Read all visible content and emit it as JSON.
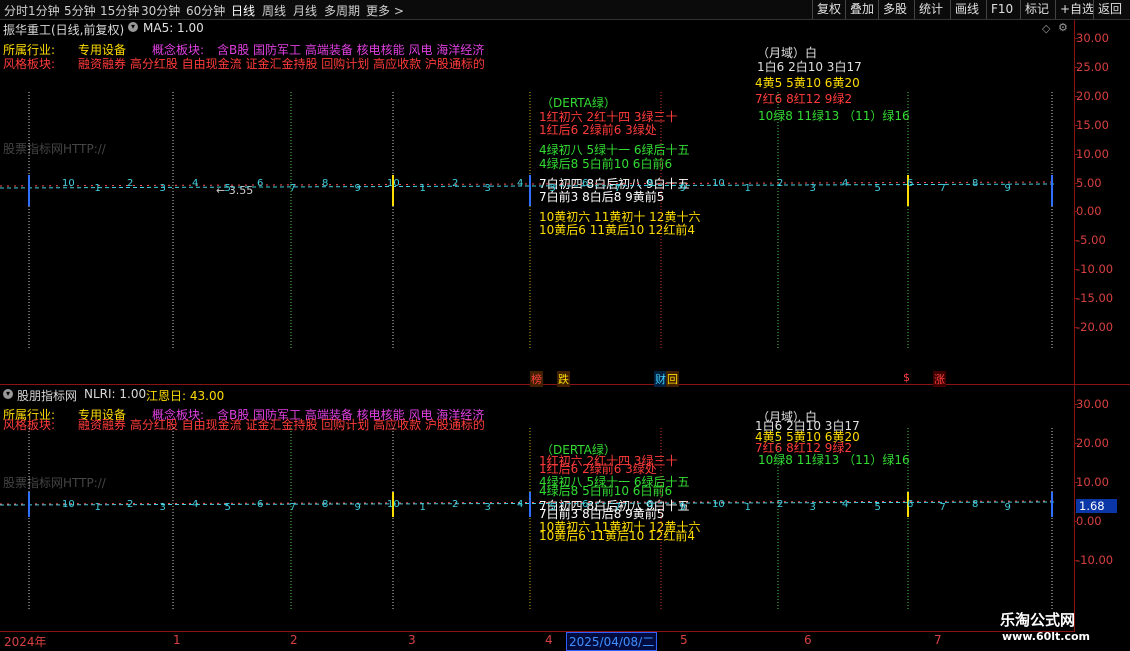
{
  "toolbar": {
    "periods": [
      "分时",
      "1分钟",
      "5分钟",
      "15分钟",
      "30分钟",
      "60分钟",
      "日线",
      "周线",
      "月线",
      "多周期",
      "更多"
    ],
    "more_arrow": ">",
    "right_buttons": [
      "复权",
      "叠加",
      "多股",
      "统计",
      "画线",
      "F10",
      "标记",
      "+自选",
      "返回"
    ]
  },
  "top_pane": {
    "stock_title": "振华重工(日线,前复权)",
    "indicator": "MA5: 1.00",
    "industry_label": "所属行业:",
    "industry_value": "专用设备",
    "concept_label": "概念板块:",
    "concept_value": "含B股 国防军工 高端装备 核电核能 风电 海洋经济",
    "style_label": "风格板块:",
    "style_value": "融资融券 高分红股 自由现金流 证金汇金持股 回购计划 高应收款 沪股通标的",
    "watermark": "股票指标网HTTP://",
    "price_marker": "← 3.55",
    "y_axis": [
      "30.00",
      "25.00",
      "20.00",
      "15.00",
      "10.00",
      "5.00",
      "0.00",
      "-5.00",
      "-10.00",
      "-15.00",
      "-20.00"
    ],
    "event_tags": [
      "榜",
      "跌",
      "财",
      "回",
      "$",
      "涨"
    ]
  },
  "calendar": {
    "month_title": "（月域）白",
    "month_row1": "1白6   2白10    3白17",
    "month_row2": "4黄5    5黄10    6黄20",
    "month_row3": "7红6   8红12    9绿2",
    "month_row4": "10绿8   11绿13  （11）绿16",
    "derta": "（DERTA绿）",
    "r1": "1红初六    2红十四    3绿三十",
    "r2": "1红后6    2绿前6      3绿处",
    "g1": "4绿初八    5绿十一    6绿后十五",
    "g2": "4绿后8     5白前10    6白前6",
    "w1": "7白初四    8白后初八     9白十五",
    "w2": "7白前3     8白后8       9黄前5",
    "y1": "10黄初六  11黄初十  12黄十六",
    "y2": "10黄后6  11黄后10  12红前4"
  },
  "bottom_pane": {
    "title": "股朋指标网",
    "indicator": "NLRI: 1.00",
    "jiang": "江恩日: 43.00",
    "y_axis": [
      "30.00",
      "20.00",
      "10.00",
      "0.00",
      "-10.00"
    ],
    "current_value": "1.68"
  },
  "x_numbers": [
    "10",
    "1",
    "2",
    "3",
    "4",
    "5",
    "6",
    "7",
    "8",
    "9",
    "10",
    "1",
    "2",
    "3",
    "4",
    "5",
    "6",
    "7",
    "8",
    "9",
    "10",
    "1",
    "2",
    "3",
    "4",
    "5",
    "6",
    "7",
    "8",
    "9"
  ],
  "date_axis": {
    "labels": [
      "2024年",
      "1",
      "2",
      "3",
      "4",
      "2025/04/08/二",
      "5",
      "6",
      "7"
    ],
    "selected": "2025/04/08/二"
  },
  "brand": {
    "name": "乐淘公式网",
    "url": "www.60lt.com"
  },
  "colors": {
    "axis_red": "#d84040",
    "yellow": "#ffdd00",
    "green": "#33dd33",
    "red": "#ff3b3b",
    "magenta": "#e040e0",
    "cyan": "#40d0e0"
  }
}
